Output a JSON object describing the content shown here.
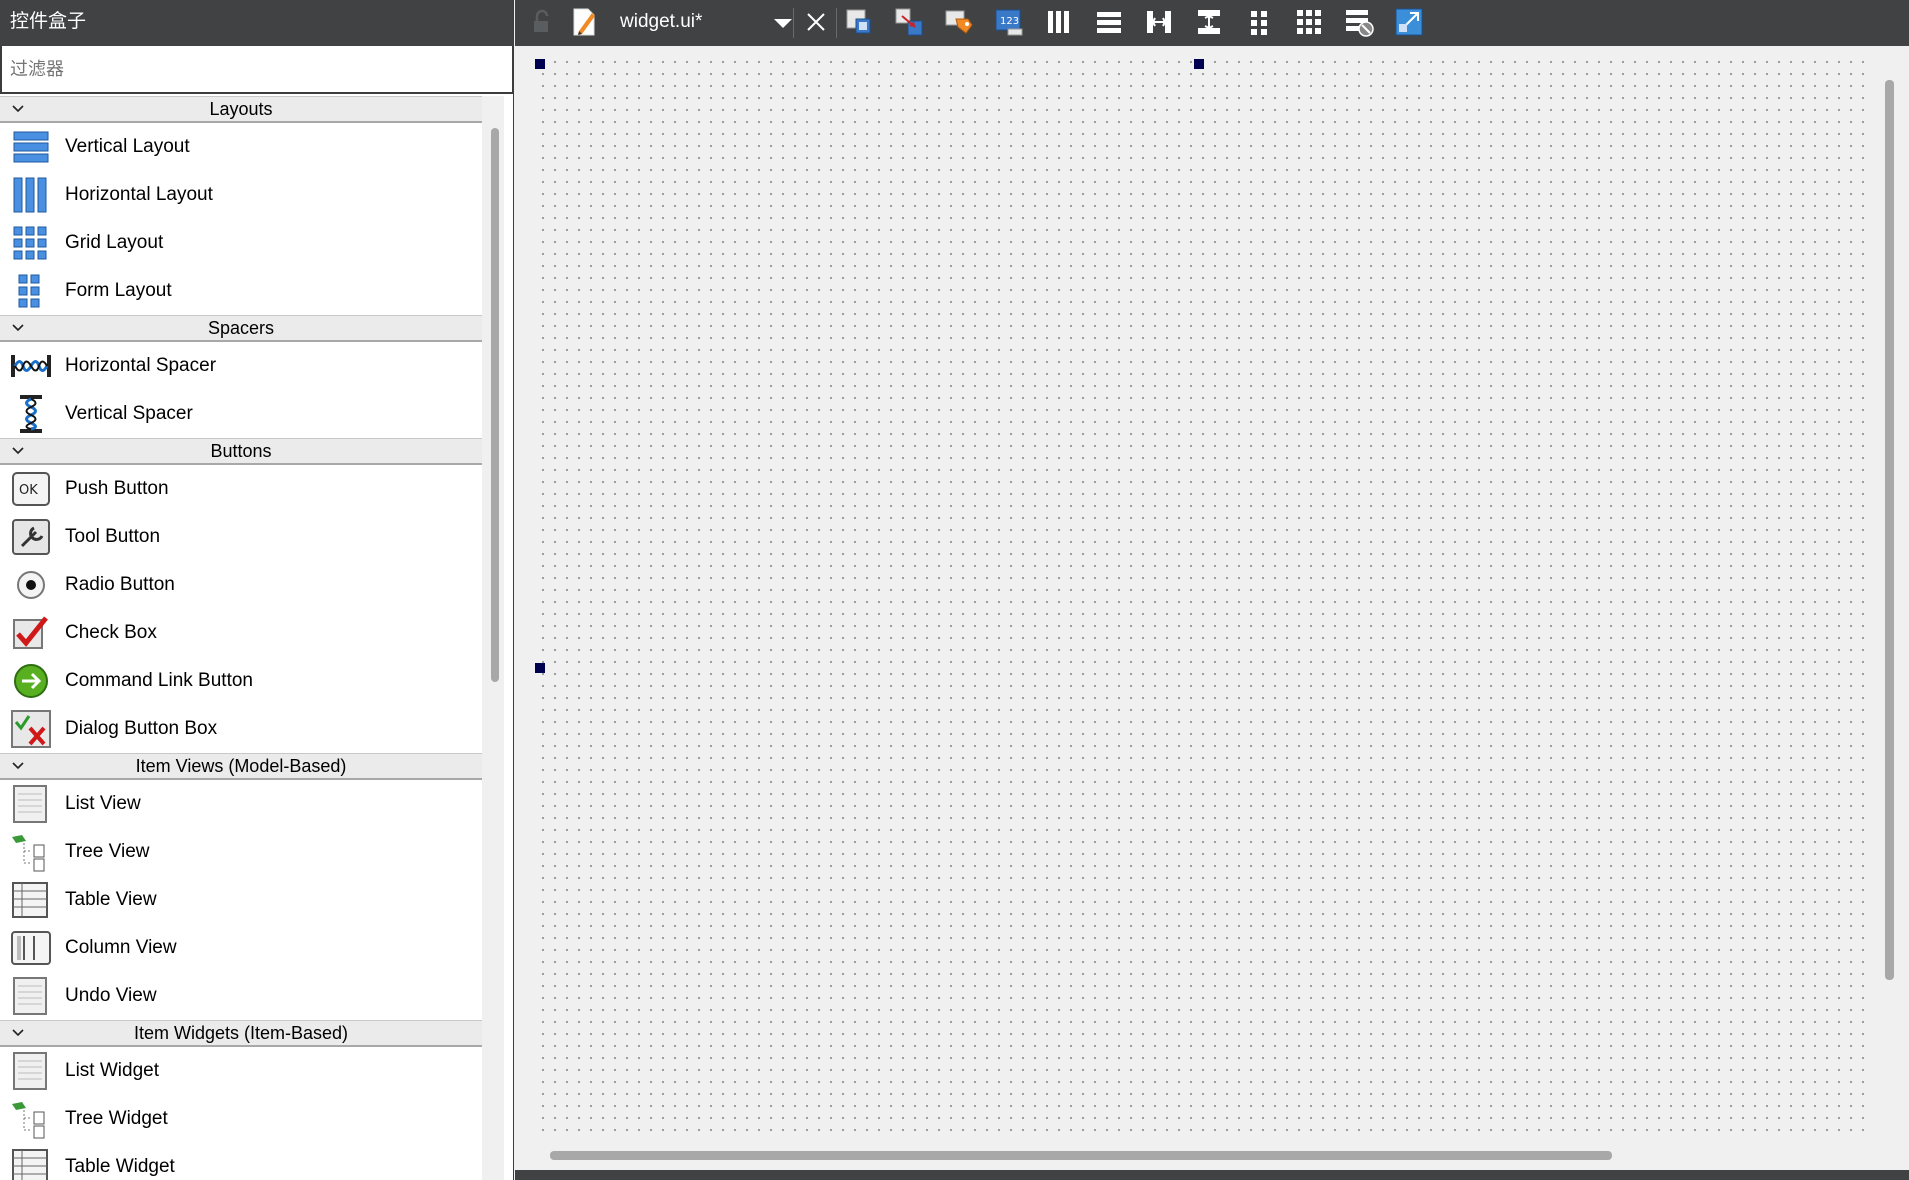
{
  "widget_box": {
    "title": "控件盒子",
    "filter_placeholder": "过滤器",
    "categories": [
      {
        "name": "Layouts",
        "items": [
          {
            "label": "Vertical Layout",
            "icon": "vertical-layout-icon"
          },
          {
            "label": "Horizontal Layout",
            "icon": "horizontal-layout-icon"
          },
          {
            "label": "Grid Layout",
            "icon": "grid-layout-icon"
          },
          {
            "label": "Form Layout",
            "icon": "form-layout-icon"
          }
        ]
      },
      {
        "name": "Spacers",
        "items": [
          {
            "label": "Horizontal Spacer",
            "icon": "horizontal-spacer-icon"
          },
          {
            "label": "Vertical Spacer",
            "icon": "vertical-spacer-icon"
          }
        ]
      },
      {
        "name": "Buttons",
        "items": [
          {
            "label": "Push Button",
            "icon": "push-button-icon"
          },
          {
            "label": "Tool Button",
            "icon": "tool-button-icon"
          },
          {
            "label": "Radio Button",
            "icon": "radio-button-icon"
          },
          {
            "label": "Check Box",
            "icon": "check-box-icon"
          },
          {
            "label": "Command Link Button",
            "icon": "command-link-icon"
          },
          {
            "label": "Dialog Button Box",
            "icon": "dialog-button-box-icon"
          }
        ]
      },
      {
        "name": "Item Views (Model-Based)",
        "items": [
          {
            "label": "List View",
            "icon": "list-view-icon"
          },
          {
            "label": "Tree View",
            "icon": "tree-view-icon"
          },
          {
            "label": "Table View",
            "icon": "table-view-icon"
          },
          {
            "label": "Column View",
            "icon": "column-view-icon"
          },
          {
            "label": "Undo View",
            "icon": "undo-view-icon"
          }
        ]
      },
      {
        "name": "Item Widgets (Item-Based)",
        "items": [
          {
            "label": "List Widget",
            "icon": "list-widget-icon"
          },
          {
            "label": "Tree Widget",
            "icon": "tree-widget-icon"
          },
          {
            "label": "Table Widget",
            "icon": "table-widget-icon"
          }
        ]
      }
    ]
  },
  "editor": {
    "file_name": "widget.ui*",
    "toolbar_icons": [
      "lock-icon",
      "edit-file-icon",
      "file-dropdown-icon",
      "close-icon",
      "edit-widgets-icon",
      "edit-signals-slots-icon",
      "edit-buddies-icon",
      "edit-tab-order-icon",
      "layout-horizontal-icon",
      "layout-vertical-icon",
      "layout-horizontal-splitter-icon",
      "layout-vertical-splitter-icon",
      "layout-form-icon",
      "layout-grid-icon",
      "break-layout-icon",
      "adjust-size-icon"
    ]
  },
  "colors": {
    "titlebar": "#404244",
    "selection_handle": "#000050",
    "canvas_bg": "#f0f0f0"
  }
}
